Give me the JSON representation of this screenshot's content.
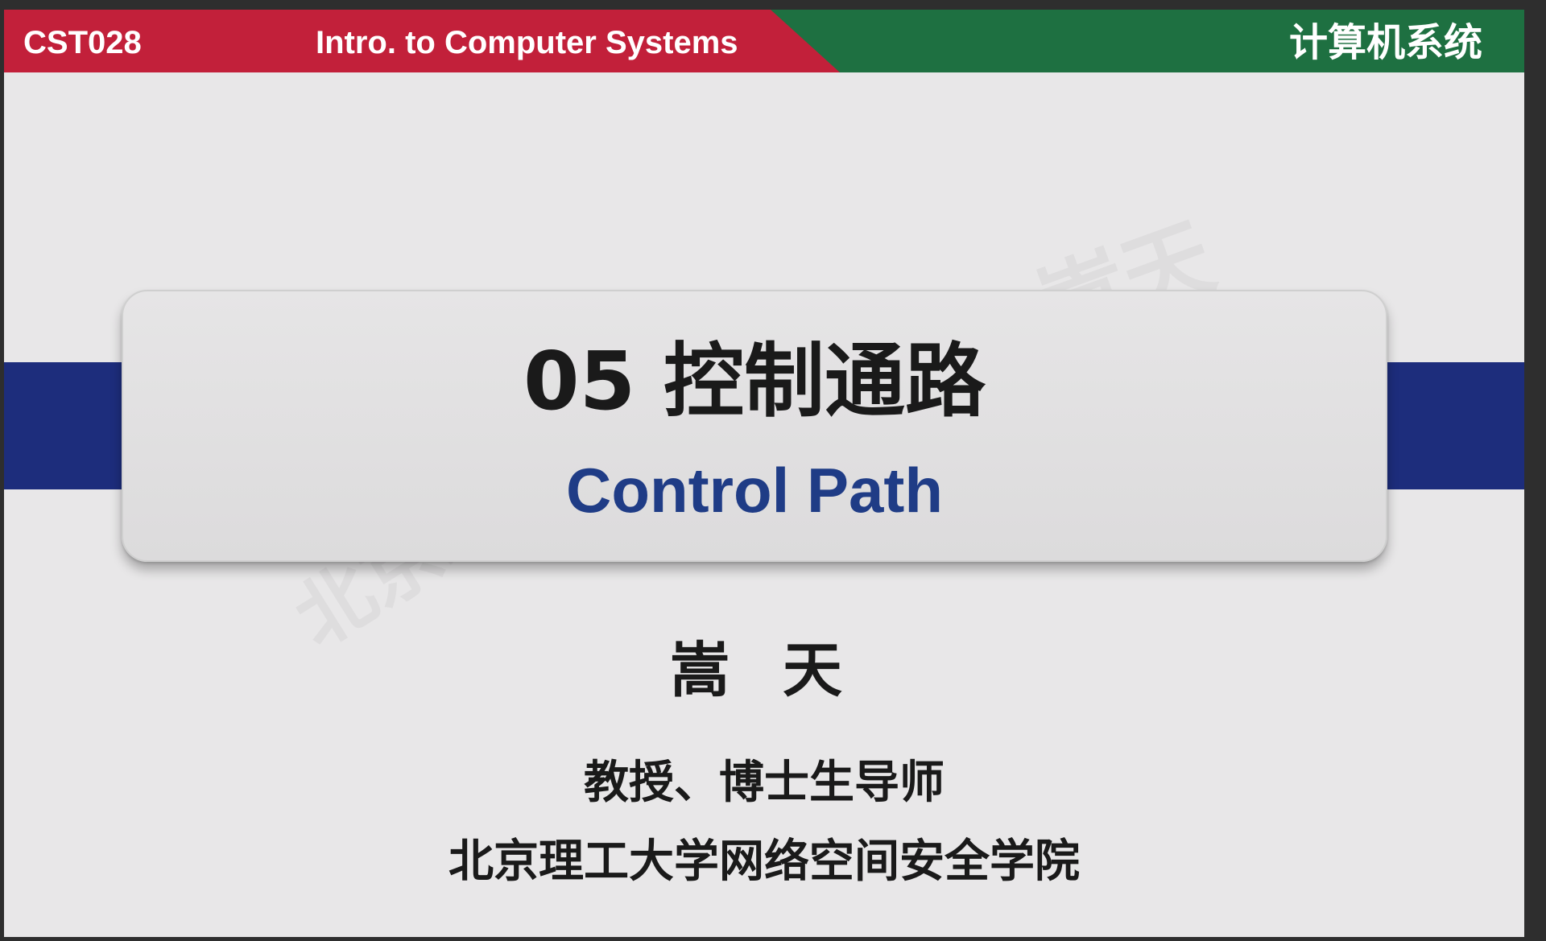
{
  "header": {
    "course_code": "CST028",
    "course_title": "Intro. to Computer Systems",
    "course_title_cn": "计算机系统"
  },
  "title_card": {
    "title": "05 控制通路",
    "subtitle": "Control Path"
  },
  "author": {
    "name": "嵩 天",
    "role": "教授、博士生导师",
    "affiliation": "北京理工大学网络空间安全学院"
  },
  "watermark": {
    "text": "北京理工大学",
    "text_2": "嵩天"
  },
  "colors": {
    "header_red": "#c2203a",
    "header_green": "#1e7041",
    "stripe_blue": "#1d2d7c",
    "subtitle_blue": "#1f3c86",
    "background": "#e8e7e8"
  }
}
